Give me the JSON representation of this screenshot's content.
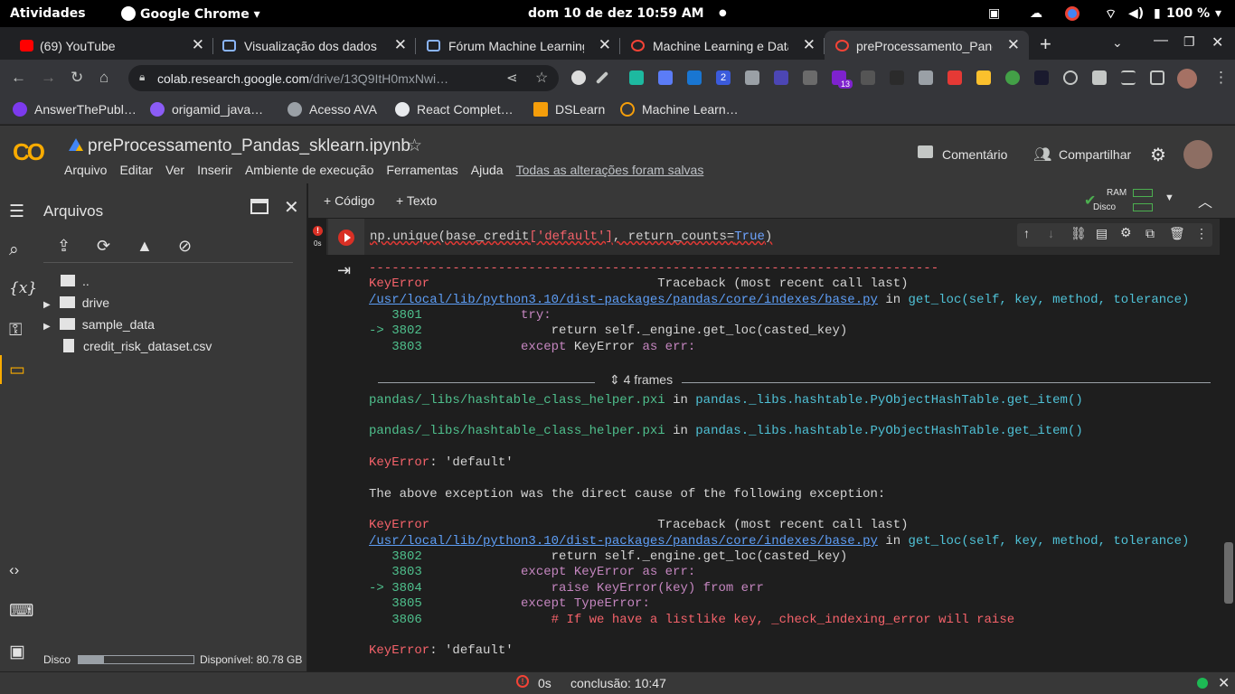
{
  "gnome": {
    "activities": "Atividades",
    "app": "Google Chrome",
    "clock": "dom 10 de dez  10:59 AM",
    "battery": "100 %"
  },
  "tabs": [
    {
      "label": "(69) YouTube",
      "color": "#ff0000"
    },
    {
      "label": "Visualização dos dados",
      "color": "#8ab4f8"
    },
    {
      "label": "Fórum Machine Learning",
      "color": "#8ab4f8"
    },
    {
      "label": "Machine Learning e Data",
      "color": "#f44336"
    },
    {
      "label": "preProcessamento_Pandas",
      "color": "#f44336"
    }
  ],
  "address": {
    "host": "colab.research.google.com",
    "path": "/drive/13Q9ItH0mxNwi…"
  },
  "ext_badges": {
    "two": "2",
    "thirteen": "13"
  },
  "bookmarks": [
    {
      "label": "AnswerThePubl…",
      "color": "#7c3aed"
    },
    {
      "label": "origamid_java…",
      "color": "#8b5cf6"
    },
    {
      "label": "Acesso AVA",
      "color": "#9aa0a6"
    },
    {
      "label": "React Complet…",
      "color": "#e8eaed"
    },
    {
      "label": "DSLearn",
      "color": "#f59e0b"
    },
    {
      "label": "Machine Learn…",
      "color": "#f59e0b"
    }
  ],
  "colab": {
    "logo": "CO",
    "notebook": "preProcessamento_Pandas_sklearn.ipynb",
    "menu": [
      "Arquivo",
      "Editar",
      "Ver",
      "Inserir",
      "Ambiente de execução",
      "Ferramentas",
      "Ajuda"
    ],
    "saved": "Todas as alterações foram salvas",
    "comment": "Comentário",
    "share": "Compartilhar"
  },
  "files": {
    "title": "Arquivos",
    "items": [
      {
        "label": "..",
        "type": "up"
      },
      {
        "label": "drive",
        "type": "folder"
      },
      {
        "label": "sample_data",
        "type": "folder"
      },
      {
        "label": "credit_risk_dataset.csv",
        "type": "file"
      }
    ],
    "disk_label": "Disco",
    "disk_available": "Disponível: 80.78 GB",
    "disk_used_fraction": 0.22
  },
  "toolbar": {
    "add_code": "+ Código",
    "add_text": "+ Texto",
    "ram": "RAM",
    "disk": "Disco"
  },
  "cell": {
    "time": "0s",
    "code_fn": "np.unique(",
    "code_arg": "base_credit",
    "code_key": "['default']",
    "code_rest": ", return_counts=",
    "code_true": "True",
    "code_close": ")"
  },
  "output": {
    "dashes": "---------------------------------------------------------------------------",
    "err1_name": "KeyError",
    "tb_header": "Traceback (most recent call last)",
    "path": "/usr/local/lib/python3.10/dist-packages/pandas/core/indexes/base.py",
    "in_word": "in",
    "get_loc": "get_loc(self, key, method, tolerance)",
    "l1_num": "   3801",
    "l1_code": "try:",
    "l2_num": "-> 3802",
    "l2_code": "return self._engine.get_loc(casted_key)",
    "l3_num": "   3803",
    "l3_code_a": "except",
    "l3_code_b": " KeyError ",
    "l3_code_c": "as err:",
    "frames": "4 frames",
    "pxi1": "pandas/_libs/hashtable_class_helper.pxi",
    "pxi1_fn": "pandas._libs.hashtable.PyObjectHashTable.get_item()",
    "pxi2": "pandas/_libs/hashtable_class_helper.pxi",
    "pxi2_fn": "pandas._libs.hashtable.PyObjectHashTable.get_item()",
    "keyerr_msg": ": 'default'",
    "cause": "The above exception was the direct cause of the following exception:",
    "m1_num": "   3802",
    "m1_code": "return self._engine.get_loc(casted_key)",
    "m2_num": "   3803",
    "m2_code": "except KeyError as err:",
    "m3_num": "-> 3804",
    "m3_code": "raise KeyError(key) from err",
    "m4_num": "   3805",
    "m4_code": "except TypeError:",
    "m5_num": "   3806",
    "m5_code": "# If we have a listlike key, _check_indexing_error will raise"
  },
  "status": {
    "time": "0s",
    "done": "conclusão: 10:47"
  }
}
